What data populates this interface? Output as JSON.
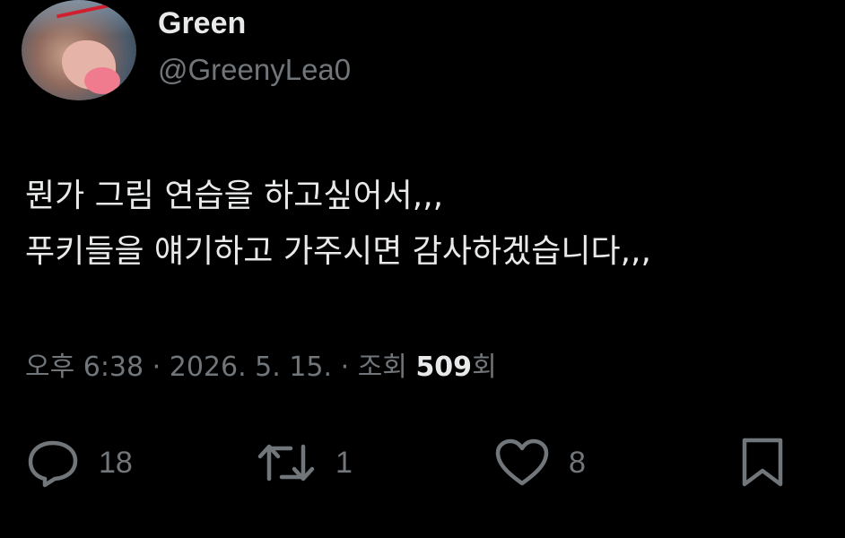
{
  "author": {
    "display_name": "Green",
    "handle": "@GreenyLea0"
  },
  "tweet": {
    "lines": [
      "뭔가 그림 연습을 하고싶어서,,,",
      "푸키들을 얘기하고 가주시면 감사하겠습니다,,,"
    ]
  },
  "meta": {
    "time": "오후 6:38",
    "separator": "·",
    "date": "2026. 5. 15.",
    "views_label": "조회",
    "views_count": "509",
    "views_suffix": "회"
  },
  "actions": {
    "reply_count": "18",
    "retweet_count": "1",
    "like_count": "8"
  },
  "colors": {
    "background": "#000000",
    "primary_text": "#e7e9ea",
    "secondary_text": "#71767b"
  }
}
